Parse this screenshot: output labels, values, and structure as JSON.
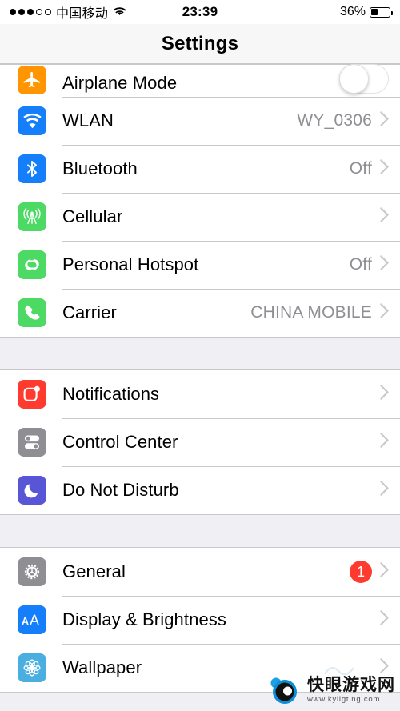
{
  "status_bar": {
    "signal_dots_filled": 3,
    "signal_dots_total": 5,
    "carrier": "中国移动",
    "wifi_icon": "wifi-icon",
    "time": "23:39",
    "battery_percent_label": "36%",
    "battery_level": 36
  },
  "nav": {
    "title": "Settings"
  },
  "groups": [
    {
      "rows": [
        {
          "label": "Airplane Mode",
          "icon": "airplane-icon",
          "icon_color": "#FF9500",
          "accessory": "toggle",
          "toggle_on": false,
          "clipped": true
        },
        {
          "label": "WLAN",
          "icon": "wifi-icon",
          "icon_color": "#147EFB",
          "value": "WY_0306",
          "accessory": "chevron"
        },
        {
          "label": "Bluetooth",
          "icon": "bluetooth-icon",
          "icon_color": "#147EFB",
          "value": "Off",
          "accessory": "chevron"
        },
        {
          "label": "Cellular",
          "icon": "cellular-antenna-icon",
          "icon_color": "#4CD964",
          "value": "",
          "accessory": "chevron"
        },
        {
          "label": "Personal Hotspot",
          "icon": "hotspot-link-icon",
          "icon_color": "#4CD964",
          "value": "Off",
          "accessory": "chevron"
        },
        {
          "label": "Carrier",
          "icon": "phone-handset-icon",
          "icon_color": "#4CD964",
          "value": "CHINA MOBILE",
          "accessory": "chevron"
        }
      ]
    },
    {
      "rows": [
        {
          "label": "Notifications",
          "icon": "notifications-icon",
          "icon_color": "#FF3B30",
          "value": "",
          "accessory": "chevron"
        },
        {
          "label": "Control Center",
          "icon": "control-center-icon",
          "icon_color": "#8E8E93",
          "value": "",
          "accessory": "chevron"
        },
        {
          "label": "Do Not Disturb",
          "icon": "moon-icon",
          "icon_color": "#5856D6",
          "value": "",
          "accessory": "chevron"
        }
      ]
    },
    {
      "rows": [
        {
          "label": "General",
          "icon": "gear-icon",
          "icon_color": "#8E8E93",
          "badge": "1",
          "accessory": "chevron"
        },
        {
          "label": "Display & Brightness",
          "icon": "aa-text-icon",
          "icon_color": "#147EFB",
          "value": "",
          "accessory": "chevron"
        },
        {
          "label": "Wallpaper",
          "icon": "wallpaper-flower-icon",
          "icon_color": "#4AAFE0",
          "value": "",
          "accessory": "chevron"
        }
      ]
    }
  ],
  "watermark": {
    "site_name": "快眼游戏网",
    "url": "www.kyligting.com"
  },
  "colors": {
    "accent_blue": "#147EFB",
    "green": "#4CD964",
    "orange": "#FF9500",
    "red": "#FF3B30",
    "gray": "#8E8E93",
    "indigo": "#5856D6",
    "group_bg": "#EFEFF4",
    "separator": "#C8C7CC"
  }
}
